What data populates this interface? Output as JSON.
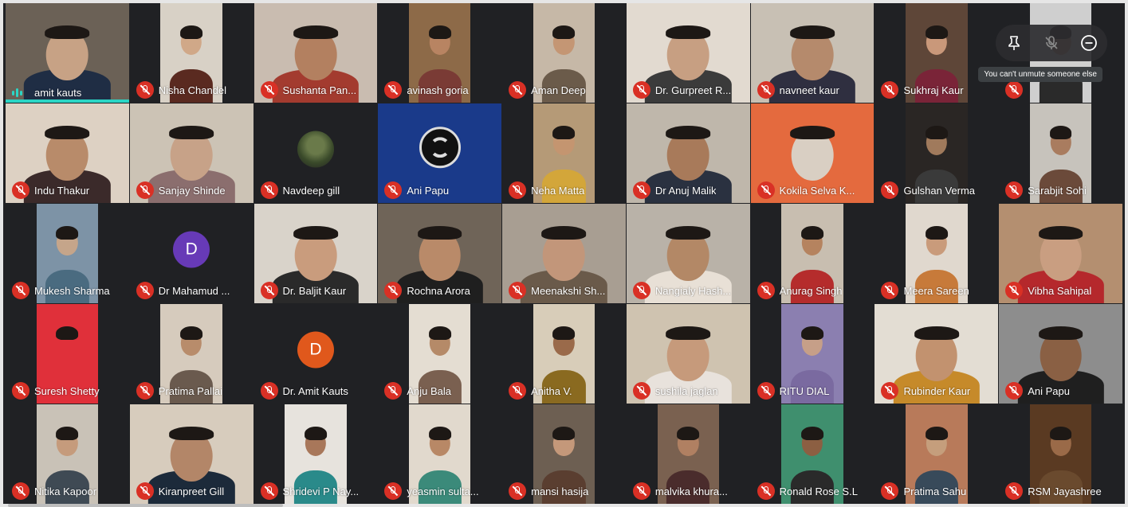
{
  "participants": [
    {
      "name": "amit kauts",
      "state": "speaking",
      "bg": "#6b6156",
      "skin": "#c7a285",
      "shirt": "#1f2d44",
      "layout": "full"
    },
    {
      "name": "Nisha Chandel",
      "state": "muted",
      "bg": "#d8d1c6",
      "skin": "#d0a888",
      "shirt": "#5a2a20",
      "layout": "mid"
    },
    {
      "name": "Sushanta Pan...",
      "state": "muted",
      "bg": "#c9bcb0",
      "skin": "#b38060",
      "shirt": "#a33b2f",
      "layout": "full"
    },
    {
      "name": "avinash goria",
      "state": "muted",
      "bg": "#8d6a48",
      "skin": "#b88462",
      "shirt": "#7a3b35",
      "layout": "mid"
    },
    {
      "name": "Aman Deep",
      "state": "muted",
      "bg": "#c6b8a7",
      "skin": "#c49674",
      "shirt": "#6b5b4a",
      "layout": "mid"
    },
    {
      "name": "Dr. Gurpreet R...",
      "state": "muted",
      "bg": "#e2dad0",
      "skin": "#c79f82",
      "shirt": "#3b3b3b",
      "layout": "full"
    },
    {
      "name": "navneet kaur",
      "state": "muted",
      "bg": "#c8c0b4",
      "skin": "#b58a6c",
      "shirt": "#2f2f40",
      "layout": "full"
    },
    {
      "name": "Sukhraj Kaur",
      "state": "muted",
      "bg": "#5e4638",
      "skin": "#c9987a",
      "shirt": "#7a2438",
      "layout": "mid"
    },
    {
      "name": "",
      "state": "muted",
      "bg": "#cfcfcf",
      "skin": "#b9906f",
      "shirt": "#2a2a2a",
      "layout": "mid"
    },
    {
      "name": "Indu Thakur",
      "state": "muted",
      "bg": "#ddd1c3",
      "skin": "#b88b6a",
      "shirt": "#3b2a2a",
      "layout": "full"
    },
    {
      "name": "Sanjay Shinde",
      "state": "muted",
      "bg": "#ccc3b5",
      "skin": "#c7a288",
      "shirt": "#8b6e6e",
      "layout": "full"
    },
    {
      "name": "Navdeep gill",
      "state": "muted",
      "bg": "#202124",
      "avatar": "photo",
      "layout": "none"
    },
    {
      "name": "Ani Papu",
      "state": "muted",
      "bg": "#1a3a8a",
      "avatar": "obs",
      "layout": "none"
    },
    {
      "name": "Neha Matta",
      "state": "muted",
      "bg": "#b59a77",
      "skin": "#c49570",
      "shirt": "#d3a63a",
      "layout": "mid"
    },
    {
      "name": "Dr Anuj Malik",
      "state": "muted",
      "bg": "#bfb7ab",
      "skin": "#a87a5a",
      "shirt": "#2a3140",
      "layout": "full"
    },
    {
      "name": "Kokila Selva K...",
      "state": "muted",
      "bg": "#e46a3e",
      "skin": "#d9cfc3",
      "shirt": "#e46a3e",
      "layout": "full"
    },
    {
      "name": "Gulshan Verma",
      "state": "muted",
      "bg": "#2a2624",
      "skin": "#a07a5c",
      "shirt": "#3a3a3a",
      "layout": "mid"
    },
    {
      "name": "Sarabjit Sohi",
      "state": "muted",
      "bg": "#c7c3bc",
      "skin": "#a97c5f",
      "shirt": "#6b4a3a",
      "layout": "mid"
    },
    {
      "name": "Mukesh Sharma",
      "state": "muted",
      "bg": "#7d93a6",
      "skin": "#c5a58a",
      "shirt": "#4a6b80",
      "layout": "mid"
    },
    {
      "name": "Dr Mahamud ...",
      "state": "muted",
      "bg": "#202124",
      "avatar": "D",
      "avatar_color": "#673ab7",
      "layout": "none"
    },
    {
      "name": "Dr. Baljit Kaur",
      "state": "muted",
      "bg": "#d9d3ca",
      "skin": "#c99c7d",
      "shirt": "#2a2a2a",
      "layout": "full"
    },
    {
      "name": "Rochna Arora",
      "state": "muted",
      "bg": "#6f6458",
      "skin": "#b98a69",
      "shirt": "#1f1f1f",
      "layout": "full"
    },
    {
      "name": "Meenakshi Sh...",
      "state": "muted",
      "bg": "#a89e92",
      "skin": "#c2967a",
      "shirt": "#6a5a4a",
      "layout": "full"
    },
    {
      "name": "Nangialy Hash...",
      "state": "muted",
      "bg": "#b9b2a8",
      "skin": "#b38866",
      "shirt": "#e8e0d6",
      "layout": "full"
    },
    {
      "name": "Anurag Singh",
      "state": "muted",
      "bg": "#c8beb0",
      "skin": "#b5835f",
      "shirt": "#b52c2c",
      "layout": "mid"
    },
    {
      "name": "Meera Sareen",
      "state": "muted",
      "bg": "#e0d8ce",
      "skin": "#c99b7b",
      "shirt": "#c77a3a",
      "layout": "mid"
    },
    {
      "name": "Vibha Sahipal",
      "state": "muted",
      "bg": "#b48f70",
      "skin": "#c99e81",
      "shirt": "#b5282c",
      "layout": "full"
    },
    {
      "name": "Suresh Shetty",
      "state": "muted",
      "bg": "#e0303a",
      "skin": "#e0303a",
      "shirt": "#e0303a",
      "layout": "mid"
    },
    {
      "name": "Pratima Pallai",
      "state": "muted",
      "bg": "#d6cbbd",
      "skin": "#b88c6b",
      "shirt": "#6a5a4e",
      "layout": "mid"
    },
    {
      "name": "Dr. Amit Kauts",
      "state": "muted",
      "bg": "#202124",
      "avatar": "D",
      "avatar_color": "#e0581c",
      "layout": "none"
    },
    {
      "name": "Anju Bala",
      "state": "muted",
      "bg": "#e4ddd2",
      "skin": "#b58a68",
      "shirt": "#7a6050",
      "layout": "mid"
    },
    {
      "name": "Anitha V.",
      "state": "muted",
      "bg": "#d8cdb9",
      "skin": "#9a6a4a",
      "shirt": "#8a6a20",
      "layout": "mid"
    },
    {
      "name": "sushila jaglan",
      "state": "muted",
      "bg": "#cfc3b0",
      "skin": "#c69a7b",
      "shirt": "#e8e2dc",
      "layout": "full"
    },
    {
      "name": "RITU DIAL",
      "state": "muted",
      "bg": "#8b7fb0",
      "skin": "#c69f88",
      "shirt": "#7a6aa0",
      "layout": "mid"
    },
    {
      "name": "Rubinder Kaur",
      "state": "muted",
      "bg": "#e3ddd3",
      "skin": "#c2926f",
      "shirt": "#c68a2a",
      "layout": "full"
    },
    {
      "name": "Ani Papu",
      "state": "muted",
      "bg": "#8d8d8d",
      "skin": "#8a6044",
      "shirt": "#1f1f1f",
      "layout": "full"
    },
    {
      "name": "Nitika Kapoor",
      "state": "muted",
      "bg": "#c9c2b7",
      "skin": "#c59b7c",
      "shirt": "#3f4a54",
      "layout": "mid"
    },
    {
      "name": "Kiranpreet Gill",
      "state": "muted",
      "bg": "#d7ccbd",
      "skin": "#b38668",
      "shirt": "#1c2a3a",
      "layout": "full"
    },
    {
      "name": "Shridevi P Nay...",
      "state": "muted",
      "bg": "#e7e3dd",
      "skin": "#a8775a",
      "shirt": "#2a8a8a",
      "layout": "mid"
    },
    {
      "name": "yeasmin sulta...",
      "state": "muted",
      "bg": "#e1d9cd",
      "skin": "#b88866",
      "shirt": "#3b8a7a",
      "layout": "mid"
    },
    {
      "name": "mansi hasija",
      "state": "muted",
      "bg": "#6d5f52",
      "skin": "#c4987a",
      "shirt": "#5a3e30",
      "layout": "mid"
    },
    {
      "name": "malvika khura...",
      "state": "muted",
      "bg": "#7a6150",
      "skin": "#b08062",
      "shirt": "#4a2c2c",
      "layout": "mid"
    },
    {
      "name": "Ronald Rose S.L",
      "state": "muted",
      "bg": "#3f8f6e",
      "skin": "#8c5f42",
      "shirt": "#2a2a2a",
      "layout": "mid"
    },
    {
      "name": "Pratima Sahu",
      "state": "muted",
      "bg": "#b87a5a",
      "skin": "#c59e7c",
      "shirt": "#384a5a",
      "layout": "mid"
    },
    {
      "name": "RSM Jayashree",
      "state": "muted",
      "bg": "#5a3a22",
      "skin": "#9a6a48",
      "shirt": "#6a4a2e",
      "layout": "mid"
    }
  ],
  "controls": {
    "tooltip": "You can't unmute someone else",
    "pin_icon": "pin-icon",
    "mute_icon": "mic-off-icon",
    "remove_icon": "remove-icon"
  },
  "colors": {
    "muted": "#d93025",
    "speaking": "#2bd5c5",
    "background": "#202124"
  }
}
